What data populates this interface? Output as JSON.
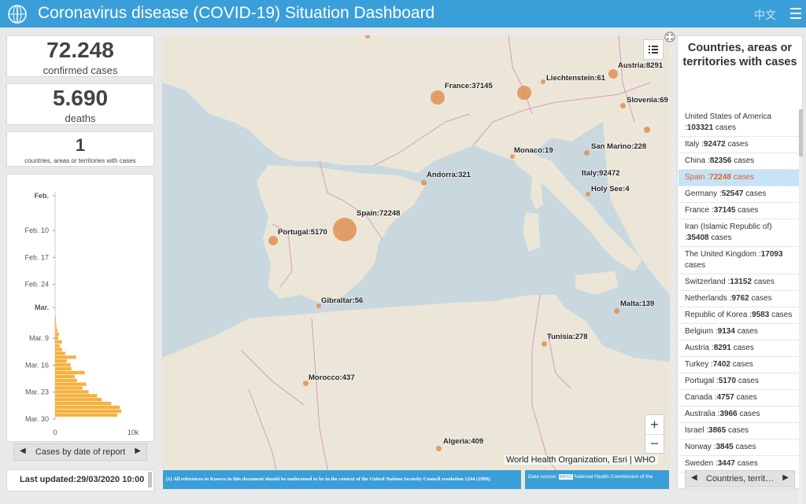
{
  "header": {
    "title": "Coronavirus disease (COVID-19) Situation Dashboard",
    "lang_label": "中文"
  },
  "stats": {
    "confirmed_value": "72.248",
    "confirmed_label": "confirmed cases",
    "deaths_value": "5.690",
    "deaths_label": "deaths",
    "countries_value": "1",
    "countries_label": "countries, areas or territories with cases"
  },
  "chart_footer": {
    "label": "Cases by date of report"
  },
  "last_updated": {
    "label": "Last updated:29/03/2020 10:00"
  },
  "chart_data": {
    "type": "bar",
    "orientation": "horizontal",
    "y_ticks": [
      "Feb.",
      "Feb. 10",
      "Feb. 17",
      "Feb. 24",
      "Mar.",
      "Mar. 9",
      "Mar. 16",
      "Mar. 23",
      "Mar. 30"
    ],
    "x_ticks": [
      "0",
      "10k"
    ],
    "xlim": [
      0,
      10000
    ],
    "color": "#f5b13f",
    "dates": [
      "Mar. 4",
      "Mar. 5",
      "Mar. 6",
      "Mar. 7",
      "Mar. 8",
      "Mar. 9",
      "Mar. 10",
      "Mar. 11",
      "Mar. 12",
      "Mar. 13",
      "Mar. 14",
      "Mar. 15",
      "Mar. 16",
      "Mar. 17",
      "Mar. 18",
      "Mar. 19",
      "Mar. 20",
      "Mar. 21",
      "Mar. 22",
      "Mar. 23",
      "Mar. 24",
      "Mar. 25",
      "Mar. 26",
      "Mar. 27",
      "Mar. 28",
      "Mar. 29"
    ],
    "values": [
      100,
      130,
      180,
      300,
      500,
      400,
      900,
      600,
      900,
      1300,
      2700,
      1500,
      2000,
      2100,
      3800,
      2500,
      2800,
      4000,
      3500,
      4300,
      5400,
      6000,
      7200,
      8300,
      8500,
      8000
    ]
  },
  "map": {
    "labels": [
      {
        "text": "France:37145"
      },
      {
        "text": "Liechtenstein:61"
      },
      {
        "text": "Austria:8291"
      },
      {
        "text": "Slovenia:69"
      },
      {
        "text": "Monaco:19"
      },
      {
        "text": "San Marino:228"
      },
      {
        "text": "Andorra:321"
      },
      {
        "text": "Italy:92472"
      },
      {
        "text": "Holy See:4"
      },
      {
        "text": "Spain:72248"
      },
      {
        "text": "Portugal:5170"
      },
      {
        "text": "Gibraltar:56"
      },
      {
        "text": "Malta:139"
      },
      {
        "text": "Tunisia:278"
      },
      {
        "text": "Morocco:437"
      },
      {
        "text": "Algeria:409"
      }
    ],
    "attribution": "World Health Organization, Esri | WHO",
    "zoom_in": "+",
    "zoom_out": "−",
    "footnote": "[1] All references to Kosovo in this document should be understood to be in the context of the United Nations Security Council resolution 1244 (1999).",
    "datasource_prefix": "Data source:",
    "datasource_who": "WHO",
    "datasource_rest": "National Health Commission of the"
  },
  "list": {
    "title": "Countries, areas or territories with cases",
    "items": [
      {
        "name": "United States of America :",
        "value": "103321",
        "suffix": " cases"
      },
      {
        "name": "Italy :",
        "value": "92472",
        "suffix": " cases"
      },
      {
        "name": "China :",
        "value": "82356",
        "suffix": " cases"
      },
      {
        "name": "Spain :",
        "value": "72248",
        "suffix": " cases",
        "selected": true
      },
      {
        "name": "Germany :",
        "value": "52547",
        "suffix": " cases"
      },
      {
        "name": "France :",
        "value": "37145",
        "suffix": " cases"
      },
      {
        "name": "Iran (Islamic Republic of) :",
        "value": "35408",
        "suffix": " cases"
      },
      {
        "name": "The United Kingdom :",
        "value": "17093",
        "suffix": " cases"
      },
      {
        "name": "Switzerland :",
        "value": "13152",
        "suffix": " cases"
      },
      {
        "name": "Netherlands :",
        "value": "9762",
        "suffix": " cases"
      },
      {
        "name": "Republic of Korea :",
        "value": "9583",
        "suffix": " cases"
      },
      {
        "name": "Belgium :",
        "value": "9134",
        "suffix": " cases"
      },
      {
        "name": "Austria :",
        "value": "8291",
        "suffix": " cases"
      },
      {
        "name": "Turkey :",
        "value": "7402",
        "suffix": " cases"
      },
      {
        "name": "Portugal :",
        "value": "5170",
        "suffix": " cases"
      },
      {
        "name": "Canada :",
        "value": "4757",
        "suffix": " cases"
      },
      {
        "name": "Australia :",
        "value": "3966",
        "suffix": " cases"
      },
      {
        "name": "Israel :",
        "value": "3865",
        "suffix": " cases"
      },
      {
        "name": "Norway :",
        "value": "3845",
        "suffix": " cases"
      },
      {
        "name": "Sweden :",
        "value": "3447",
        "suffix": " cases"
      }
    ],
    "footer_label": "Countries, territ…"
  }
}
